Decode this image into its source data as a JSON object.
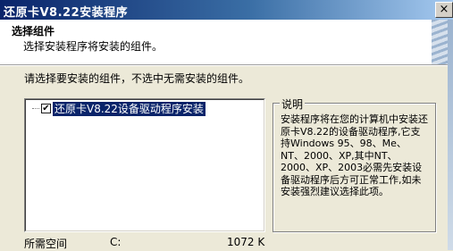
{
  "window": {
    "title": "还原卡V8.22安装程序",
    "close_glyph": "×"
  },
  "header": {
    "title": "选择组件",
    "subtitle": "选择安装程序将安装的组件。"
  },
  "instruction": "请选择要安装的组件，不选中无需安装的组件。",
  "components": [
    {
      "label": "还原卡V8.22设备驱动程序安装",
      "checked": true,
      "check_glyph": "✔"
    }
  ],
  "description": {
    "title": "说明",
    "text": "安装程序将在您的计算机中安装还原卡V8.22的设备驱动程序,它支持Windows 95、98、Me、NT、2000、XP,其中NT、2000、XP、2003必需先安装设备驱动程序后方可正常工作,如未安装强烈建议选择此项。"
  },
  "space": {
    "label": "所需空间",
    "drive": "C:",
    "size": "1072 K"
  },
  "colors": {
    "title_bar_start": "#0a246a",
    "title_bar_end": "#a6caf0",
    "selection": "#0a246a",
    "dialog_bg": "#ece9d8"
  }
}
